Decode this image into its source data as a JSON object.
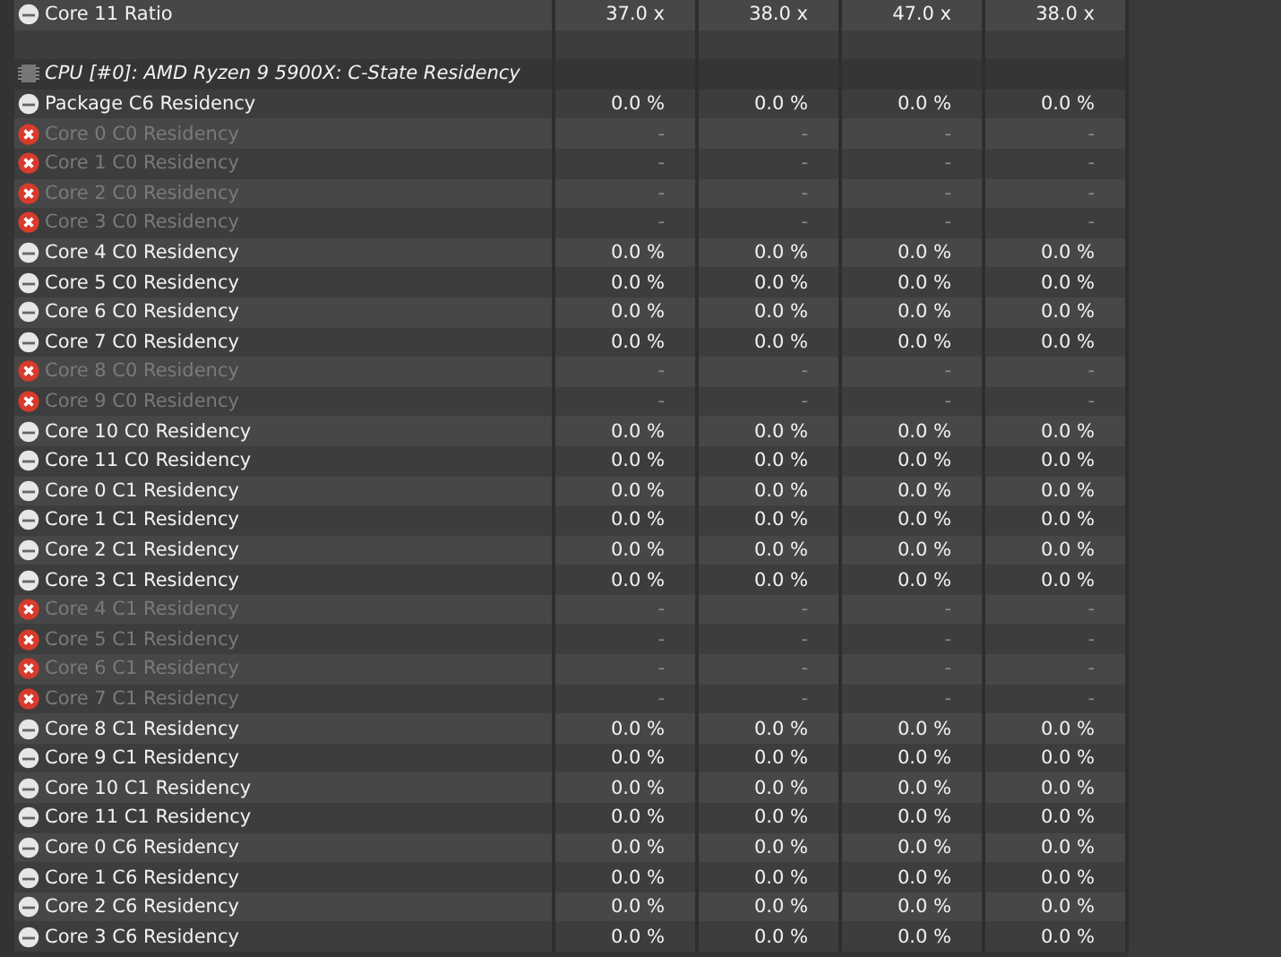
{
  "rows": [
    {
      "kind": "sensor",
      "label": "Core 11 Ratio",
      "disabled": false,
      "values": [
        "37.0 x",
        "38.0 x",
        "47.0 x",
        "38.0 x"
      ]
    },
    {
      "kind": "blank"
    },
    {
      "kind": "group",
      "label": "CPU [#0]: AMD Ryzen 9 5900X: C-State Residency"
    },
    {
      "kind": "sensor",
      "label": "Package C6 Residency",
      "disabled": false,
      "values": [
        "0.0 %",
        "0.0 %",
        "0.0 %",
        "0.0 %"
      ]
    },
    {
      "kind": "sensor",
      "label": "Core 0 C0 Residency",
      "disabled": true,
      "values": [
        "-",
        "-",
        "-",
        "-"
      ]
    },
    {
      "kind": "sensor",
      "label": "Core 1 C0 Residency",
      "disabled": true,
      "values": [
        "-",
        "-",
        "-",
        "-"
      ]
    },
    {
      "kind": "sensor",
      "label": "Core 2 C0 Residency",
      "disabled": true,
      "values": [
        "-",
        "-",
        "-",
        "-"
      ]
    },
    {
      "kind": "sensor",
      "label": "Core 3 C0 Residency",
      "disabled": true,
      "values": [
        "-",
        "-",
        "-",
        "-"
      ]
    },
    {
      "kind": "sensor",
      "label": "Core 4 C0 Residency",
      "disabled": false,
      "values": [
        "0.0 %",
        "0.0 %",
        "0.0 %",
        "0.0 %"
      ]
    },
    {
      "kind": "sensor",
      "label": "Core 5 C0 Residency",
      "disabled": false,
      "values": [
        "0.0 %",
        "0.0 %",
        "0.0 %",
        "0.0 %"
      ]
    },
    {
      "kind": "sensor",
      "label": "Core 6 C0 Residency",
      "disabled": false,
      "values": [
        "0.0 %",
        "0.0 %",
        "0.0 %",
        "0.0 %"
      ]
    },
    {
      "kind": "sensor",
      "label": "Core 7 C0 Residency",
      "disabled": false,
      "values": [
        "0.0 %",
        "0.0 %",
        "0.0 %",
        "0.0 %"
      ]
    },
    {
      "kind": "sensor",
      "label": "Core 8 C0 Residency",
      "disabled": true,
      "values": [
        "-",
        "-",
        "-",
        "-"
      ]
    },
    {
      "kind": "sensor",
      "label": "Core 9 C0 Residency",
      "disabled": true,
      "values": [
        "-",
        "-",
        "-",
        "-"
      ]
    },
    {
      "kind": "sensor",
      "label": "Core 10 C0 Residency",
      "disabled": false,
      "values": [
        "0.0 %",
        "0.0 %",
        "0.0 %",
        "0.0 %"
      ]
    },
    {
      "kind": "sensor",
      "label": "Core 11 C0 Residency",
      "disabled": false,
      "values": [
        "0.0 %",
        "0.0 %",
        "0.0 %",
        "0.0 %"
      ]
    },
    {
      "kind": "sensor",
      "label": "Core 0 C1 Residency",
      "disabled": false,
      "values": [
        "0.0 %",
        "0.0 %",
        "0.0 %",
        "0.0 %"
      ]
    },
    {
      "kind": "sensor",
      "label": "Core 1 C1 Residency",
      "disabled": false,
      "values": [
        "0.0 %",
        "0.0 %",
        "0.0 %",
        "0.0 %"
      ]
    },
    {
      "kind": "sensor",
      "label": "Core 2 C1 Residency",
      "disabled": false,
      "values": [
        "0.0 %",
        "0.0 %",
        "0.0 %",
        "0.0 %"
      ]
    },
    {
      "kind": "sensor",
      "label": "Core 3 C1 Residency",
      "disabled": false,
      "values": [
        "0.0 %",
        "0.0 %",
        "0.0 %",
        "0.0 %"
      ]
    },
    {
      "kind": "sensor",
      "label": "Core 4 C1 Residency",
      "disabled": true,
      "values": [
        "-",
        "-",
        "-",
        "-"
      ]
    },
    {
      "kind": "sensor",
      "label": "Core 5 C1 Residency",
      "disabled": true,
      "values": [
        "-",
        "-",
        "-",
        "-"
      ]
    },
    {
      "kind": "sensor",
      "label": "Core 6 C1 Residency",
      "disabled": true,
      "values": [
        "-",
        "-",
        "-",
        "-"
      ]
    },
    {
      "kind": "sensor",
      "label": "Core 7 C1 Residency",
      "disabled": true,
      "values": [
        "-",
        "-",
        "-",
        "-"
      ]
    },
    {
      "kind": "sensor",
      "label": "Core 8 C1 Residency",
      "disabled": false,
      "values": [
        "0.0 %",
        "0.0 %",
        "0.0 %",
        "0.0 %"
      ]
    },
    {
      "kind": "sensor",
      "label": "Core 9 C1 Residency",
      "disabled": false,
      "values": [
        "0.0 %",
        "0.0 %",
        "0.0 %",
        "0.0 %"
      ]
    },
    {
      "kind": "sensor",
      "label": "Core 10 C1 Residency",
      "disabled": false,
      "values": [
        "0.0 %",
        "0.0 %",
        "0.0 %",
        "0.0 %"
      ]
    },
    {
      "kind": "sensor",
      "label": "Core 11 C1 Residency",
      "disabled": false,
      "values": [
        "0.0 %",
        "0.0 %",
        "0.0 %",
        "0.0 %"
      ]
    },
    {
      "kind": "sensor",
      "label": "Core 0 C6 Residency",
      "disabled": false,
      "values": [
        "0.0 %",
        "0.0 %",
        "0.0 %",
        "0.0 %"
      ]
    },
    {
      "kind": "sensor",
      "label": "Core 1 C6 Residency",
      "disabled": false,
      "values": [
        "0.0 %",
        "0.0 %",
        "0.0 %",
        "0.0 %"
      ]
    },
    {
      "kind": "sensor",
      "label": "Core 2 C6 Residency",
      "disabled": false,
      "values": [
        "0.0 %",
        "0.0 %",
        "0.0 %",
        "0.0 %"
      ]
    },
    {
      "kind": "sensor",
      "label": "Core 3 C6 Residency",
      "disabled": false,
      "values": [
        "0.0 %",
        "0.0 %",
        "0.0 %",
        "0.0 %"
      ]
    }
  ]
}
